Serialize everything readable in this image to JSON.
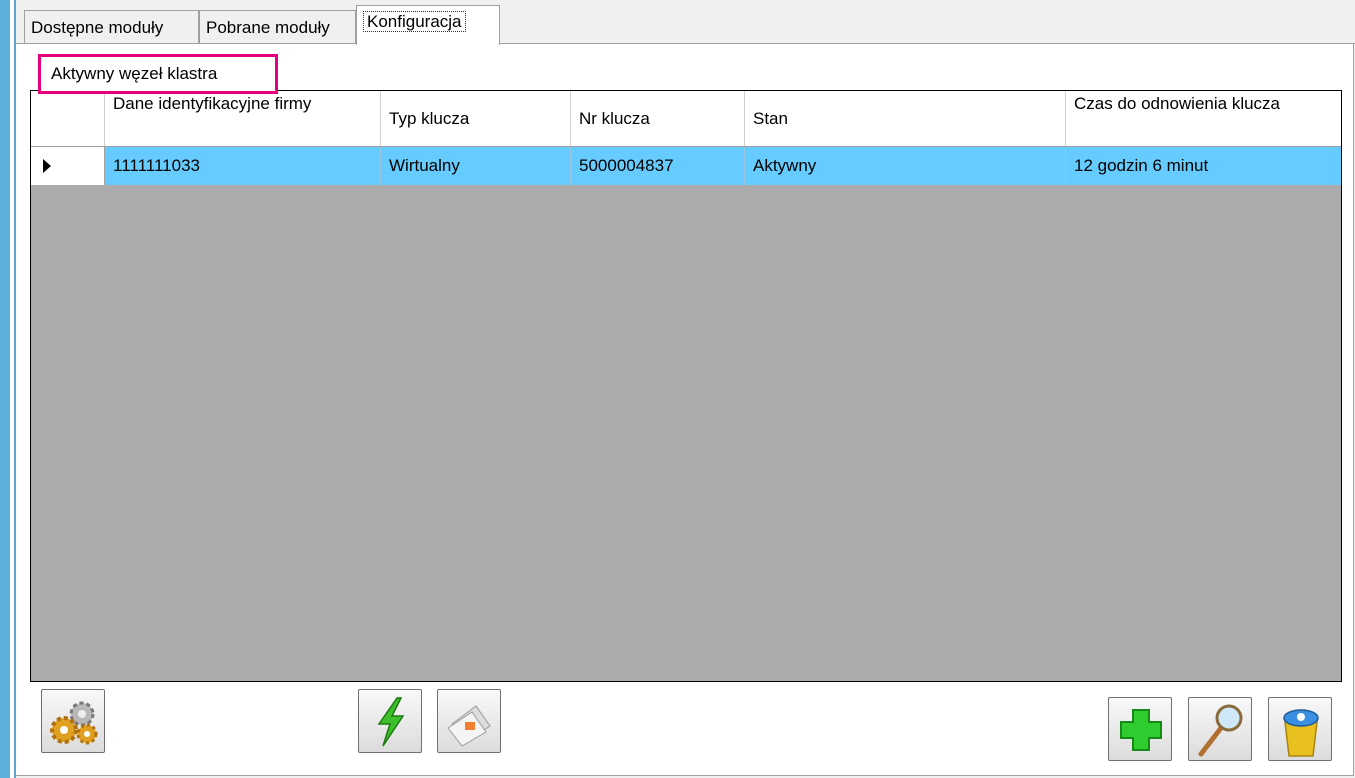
{
  "tabs": [
    {
      "label": "Dostępne moduły"
    },
    {
      "label": "Pobrane moduły"
    },
    {
      "label": "Konfiguracja"
    }
  ],
  "group": {
    "label": "Aktywny węzeł klastra"
  },
  "table": {
    "columns": [
      "Dane identyfikacyjne firmy",
      "Typ klucza",
      "Nr klucza",
      "Stan",
      "Czas do odnowienia klucza"
    ],
    "rows": [
      {
        "dane": "1111111033",
        "typ": "Wirtualny",
        "nr": "5000004837",
        "stan": "Aktywny",
        "czas": "12 godzin 6 minut"
      }
    ]
  },
  "toolbar": {
    "left_icon": "gears-icon",
    "middle_icons": [
      "lightning-icon",
      "documents-icon"
    ],
    "right_icons": [
      "add-icon",
      "search-icon",
      "trash-icon"
    ]
  },
  "colors": {
    "selection": "#66ccff",
    "highlight_border": "#e6007e",
    "grid_background": "#ababab"
  }
}
